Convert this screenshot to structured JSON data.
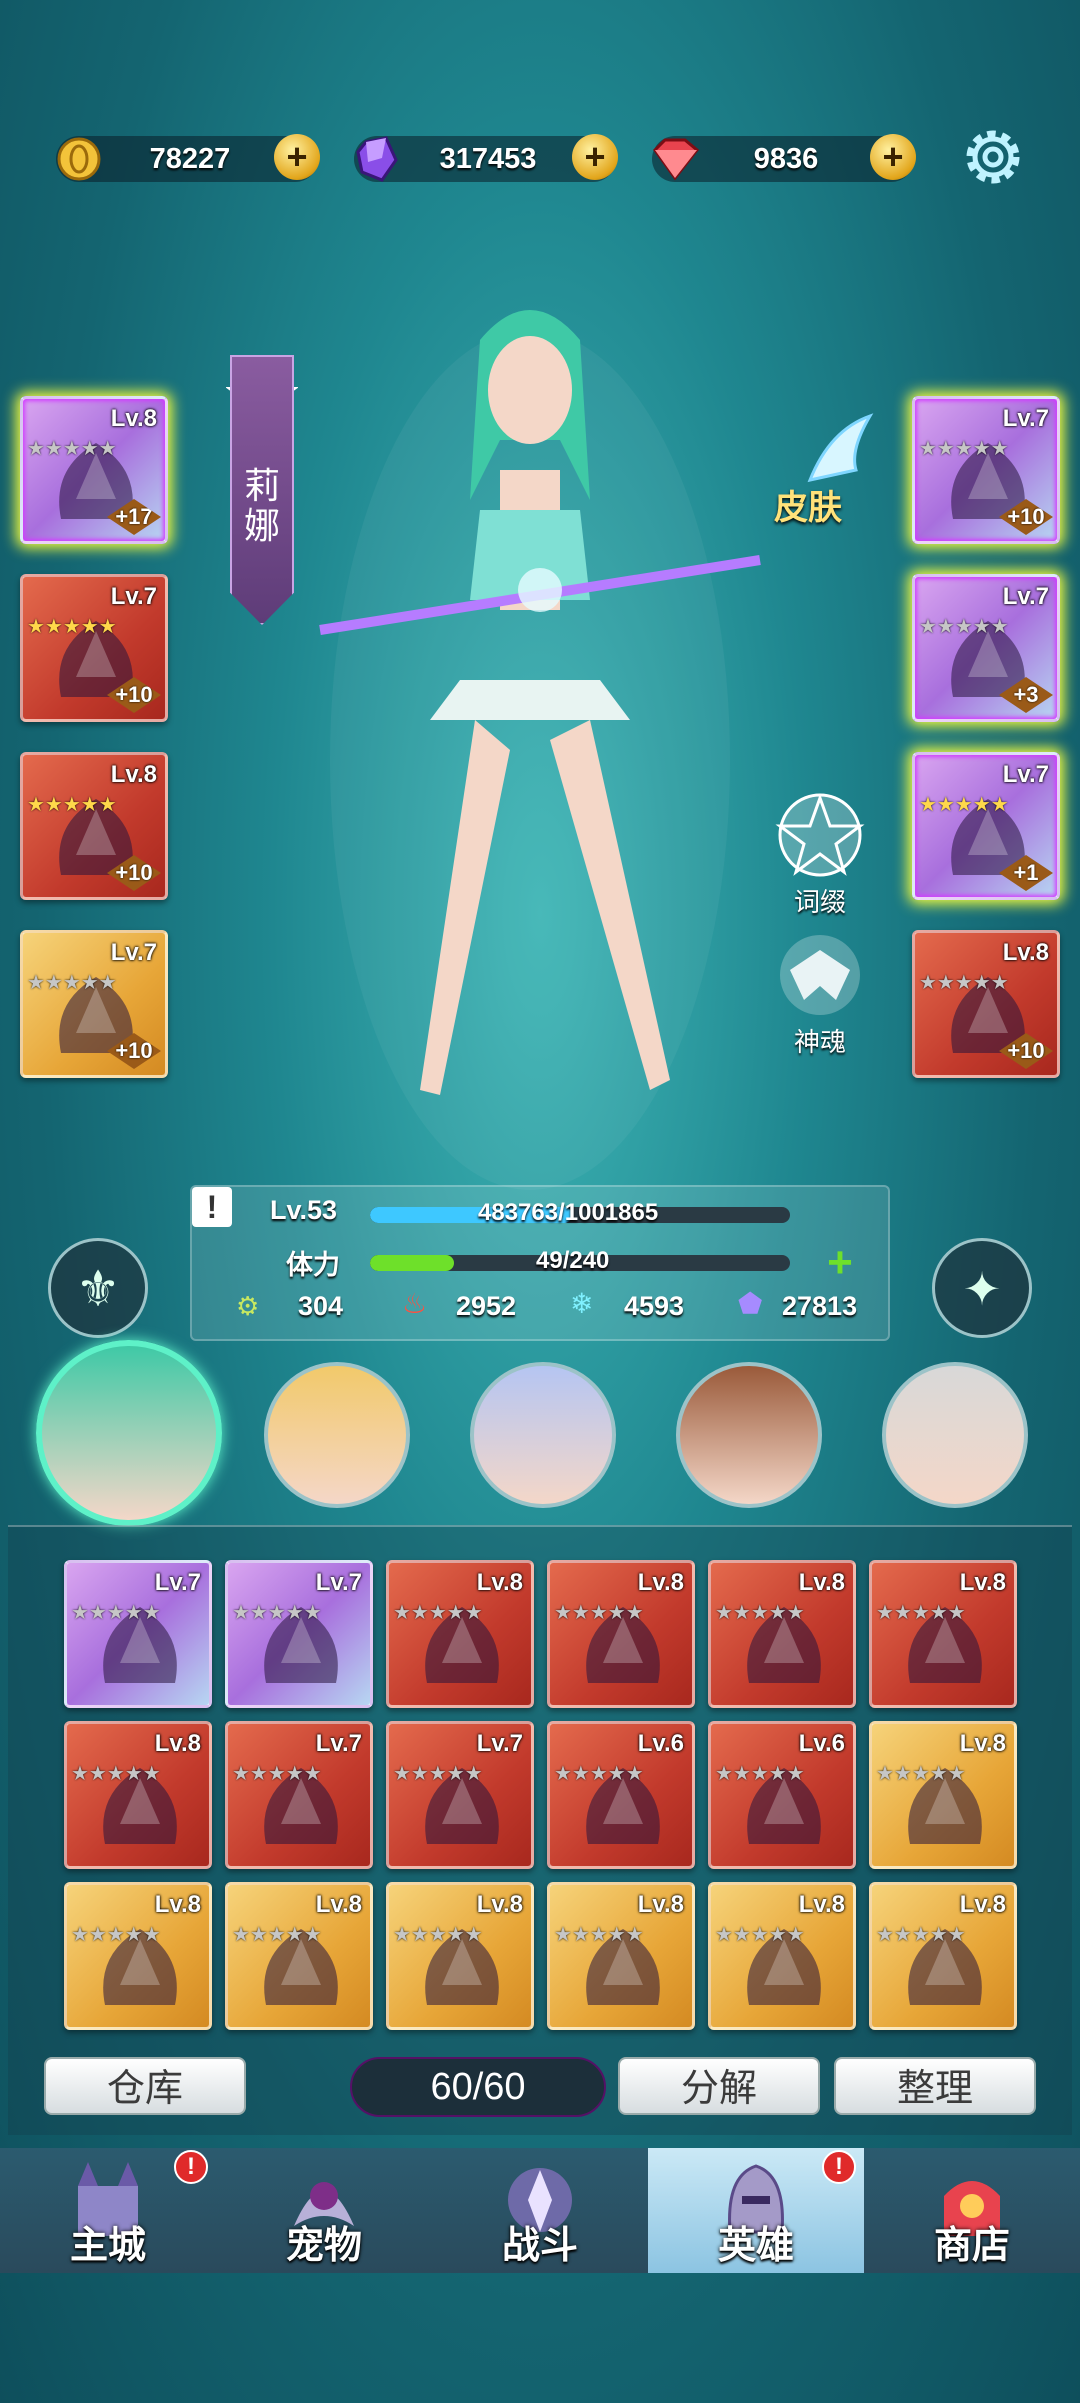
{
  "currencies": [
    {
      "name": "gold",
      "value": "78227",
      "color": "#f3c33a"
    },
    {
      "name": "crystal",
      "value": "317453",
      "color": "#8a4ee8"
    },
    {
      "name": "ruby",
      "value": "9836",
      "color": "#e8434e"
    }
  ],
  "hero": {
    "name": "莉娜",
    "skin_label": "皮肤",
    "affix_label": "词缀",
    "soul_label": "神魂"
  },
  "stats": {
    "level": "Lv.53",
    "exp": "483763/1001865",
    "exp_fraction": 0.48,
    "stamina_label": "体力",
    "stamina": "49/240",
    "stamina_fraction": 0.2,
    "attrs": [
      "304",
      "2952",
      "4593",
      "27813"
    ]
  },
  "equipped_left": [
    {
      "lv": "Lv.8",
      "plus": "+17",
      "color": "purple",
      "glow": true,
      "stars": "gray"
    },
    {
      "lv": "Lv.7",
      "plus": "+10",
      "color": "red",
      "stars": "yellow"
    },
    {
      "lv": "Lv.8",
      "plus": "+10",
      "color": "red",
      "stars": "yellow"
    },
    {
      "lv": "Lv.7",
      "plus": "+10",
      "color": "gold",
      "stars": "gray"
    }
  ],
  "equipped_right": [
    {
      "lv": "Lv.7",
      "plus": "+10",
      "color": "purple",
      "glow": true,
      "stars": "gray"
    },
    {
      "lv": "Lv.7",
      "plus": "+3",
      "color": "purple",
      "glow": true,
      "stars": "gray"
    },
    {
      "lv": "Lv.7",
      "plus": "+1",
      "color": "purple",
      "glow": true,
      "stars": "yellow"
    },
    {
      "lv": "Lv.8",
      "plus": "+10",
      "color": "red",
      "stars": "gray"
    }
  ],
  "inventory": [
    {
      "lv": "Lv.7",
      "color": "purple"
    },
    {
      "lv": "Lv.7",
      "color": "purple"
    },
    {
      "lv": "Lv.8",
      "color": "red"
    },
    {
      "lv": "Lv.8",
      "color": "red"
    },
    {
      "lv": "Lv.8",
      "color": "red"
    },
    {
      "lv": "Lv.8",
      "color": "red"
    },
    {
      "lv": "Lv.8",
      "color": "red"
    },
    {
      "lv": "Lv.7",
      "color": "red"
    },
    {
      "lv": "Lv.7",
      "color": "red"
    },
    {
      "lv": "Lv.6",
      "color": "red"
    },
    {
      "lv": "Lv.6",
      "color": "red"
    },
    {
      "lv": "Lv.8",
      "color": "gold"
    },
    {
      "lv": "Lv.8",
      "color": "gold"
    },
    {
      "lv": "Lv.8",
      "color": "gold"
    },
    {
      "lv": "Lv.8",
      "color": "gold"
    },
    {
      "lv": "Lv.8",
      "color": "gold"
    },
    {
      "lv": "Lv.8",
      "color": "gold"
    },
    {
      "lv": "Lv.8",
      "color": "gold"
    }
  ],
  "inventory_actions": {
    "warehouse": "仓库",
    "capacity": "60/60",
    "decompose": "分解",
    "sort": "整理"
  },
  "nav": [
    {
      "label": "主城",
      "alert": true
    },
    {
      "label": "宠物",
      "alert": false
    },
    {
      "label": "战斗",
      "alert": false
    },
    {
      "label": "英雄",
      "alert": true,
      "selected": true
    },
    {
      "label": "商店",
      "alert": false
    }
  ],
  "alert_mark": "!"
}
